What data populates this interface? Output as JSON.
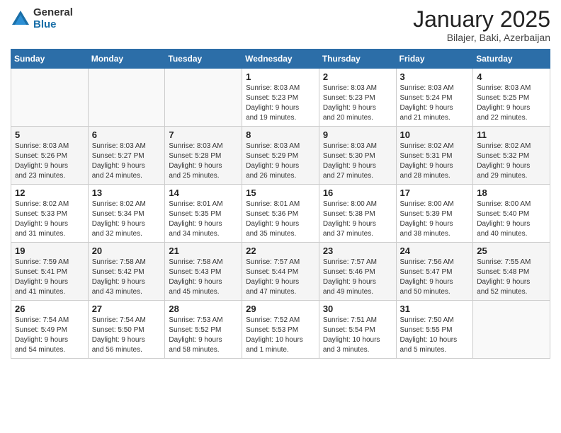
{
  "logo": {
    "general": "General",
    "blue": "Blue"
  },
  "title": "January 2025",
  "location": "Bilajer, Baki, Azerbaijan",
  "weekdays": [
    "Sunday",
    "Monday",
    "Tuesday",
    "Wednesday",
    "Thursday",
    "Friday",
    "Saturday"
  ],
  "weeks": [
    [
      {
        "day": "",
        "info": ""
      },
      {
        "day": "",
        "info": ""
      },
      {
        "day": "",
        "info": ""
      },
      {
        "day": "1",
        "info": "Sunrise: 8:03 AM\nSunset: 5:23 PM\nDaylight: 9 hours\nand 19 minutes."
      },
      {
        "day": "2",
        "info": "Sunrise: 8:03 AM\nSunset: 5:23 PM\nDaylight: 9 hours\nand 20 minutes."
      },
      {
        "day": "3",
        "info": "Sunrise: 8:03 AM\nSunset: 5:24 PM\nDaylight: 9 hours\nand 21 minutes."
      },
      {
        "day": "4",
        "info": "Sunrise: 8:03 AM\nSunset: 5:25 PM\nDaylight: 9 hours\nand 22 minutes."
      }
    ],
    [
      {
        "day": "5",
        "info": "Sunrise: 8:03 AM\nSunset: 5:26 PM\nDaylight: 9 hours\nand 23 minutes."
      },
      {
        "day": "6",
        "info": "Sunrise: 8:03 AM\nSunset: 5:27 PM\nDaylight: 9 hours\nand 24 minutes."
      },
      {
        "day": "7",
        "info": "Sunrise: 8:03 AM\nSunset: 5:28 PM\nDaylight: 9 hours\nand 25 minutes."
      },
      {
        "day": "8",
        "info": "Sunrise: 8:03 AM\nSunset: 5:29 PM\nDaylight: 9 hours\nand 26 minutes."
      },
      {
        "day": "9",
        "info": "Sunrise: 8:03 AM\nSunset: 5:30 PM\nDaylight: 9 hours\nand 27 minutes."
      },
      {
        "day": "10",
        "info": "Sunrise: 8:02 AM\nSunset: 5:31 PM\nDaylight: 9 hours\nand 28 minutes."
      },
      {
        "day": "11",
        "info": "Sunrise: 8:02 AM\nSunset: 5:32 PM\nDaylight: 9 hours\nand 29 minutes."
      }
    ],
    [
      {
        "day": "12",
        "info": "Sunrise: 8:02 AM\nSunset: 5:33 PM\nDaylight: 9 hours\nand 31 minutes."
      },
      {
        "day": "13",
        "info": "Sunrise: 8:02 AM\nSunset: 5:34 PM\nDaylight: 9 hours\nand 32 minutes."
      },
      {
        "day": "14",
        "info": "Sunrise: 8:01 AM\nSunset: 5:35 PM\nDaylight: 9 hours\nand 34 minutes."
      },
      {
        "day": "15",
        "info": "Sunrise: 8:01 AM\nSunset: 5:36 PM\nDaylight: 9 hours\nand 35 minutes."
      },
      {
        "day": "16",
        "info": "Sunrise: 8:00 AM\nSunset: 5:38 PM\nDaylight: 9 hours\nand 37 minutes."
      },
      {
        "day": "17",
        "info": "Sunrise: 8:00 AM\nSunset: 5:39 PM\nDaylight: 9 hours\nand 38 minutes."
      },
      {
        "day": "18",
        "info": "Sunrise: 8:00 AM\nSunset: 5:40 PM\nDaylight: 9 hours\nand 40 minutes."
      }
    ],
    [
      {
        "day": "19",
        "info": "Sunrise: 7:59 AM\nSunset: 5:41 PM\nDaylight: 9 hours\nand 41 minutes."
      },
      {
        "day": "20",
        "info": "Sunrise: 7:58 AM\nSunset: 5:42 PM\nDaylight: 9 hours\nand 43 minutes."
      },
      {
        "day": "21",
        "info": "Sunrise: 7:58 AM\nSunset: 5:43 PM\nDaylight: 9 hours\nand 45 minutes."
      },
      {
        "day": "22",
        "info": "Sunrise: 7:57 AM\nSunset: 5:44 PM\nDaylight: 9 hours\nand 47 minutes."
      },
      {
        "day": "23",
        "info": "Sunrise: 7:57 AM\nSunset: 5:46 PM\nDaylight: 9 hours\nand 49 minutes."
      },
      {
        "day": "24",
        "info": "Sunrise: 7:56 AM\nSunset: 5:47 PM\nDaylight: 9 hours\nand 50 minutes."
      },
      {
        "day": "25",
        "info": "Sunrise: 7:55 AM\nSunset: 5:48 PM\nDaylight: 9 hours\nand 52 minutes."
      }
    ],
    [
      {
        "day": "26",
        "info": "Sunrise: 7:54 AM\nSunset: 5:49 PM\nDaylight: 9 hours\nand 54 minutes."
      },
      {
        "day": "27",
        "info": "Sunrise: 7:54 AM\nSunset: 5:50 PM\nDaylight: 9 hours\nand 56 minutes."
      },
      {
        "day": "28",
        "info": "Sunrise: 7:53 AM\nSunset: 5:52 PM\nDaylight: 9 hours\nand 58 minutes."
      },
      {
        "day": "29",
        "info": "Sunrise: 7:52 AM\nSunset: 5:53 PM\nDaylight: 10 hours\nand 1 minute."
      },
      {
        "day": "30",
        "info": "Sunrise: 7:51 AM\nSunset: 5:54 PM\nDaylight: 10 hours\nand 3 minutes."
      },
      {
        "day": "31",
        "info": "Sunrise: 7:50 AM\nSunset: 5:55 PM\nDaylight: 10 hours\nand 5 minutes."
      },
      {
        "day": "",
        "info": ""
      }
    ]
  ]
}
